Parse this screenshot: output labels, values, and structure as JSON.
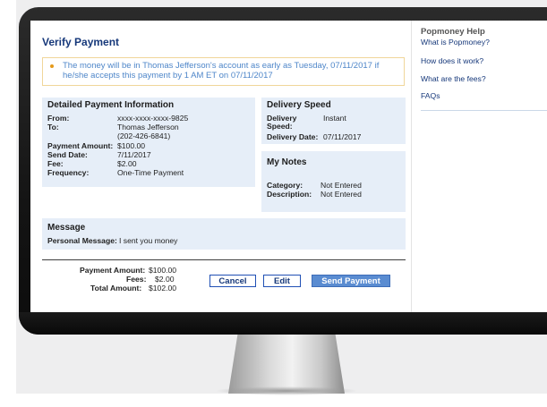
{
  "page": {
    "title": "Verify Payment",
    "notice": "The money will be in Thomas Jefferson's account as early as Tuesday, 07/11/2017 if he/she accepts this payment by 1 AM ET on 07/11/2017"
  },
  "details": {
    "title": "Detailed Payment Information",
    "from_label": "From:",
    "from_value": "xxxx-xxxx-xxxx-9825",
    "to_label": "To:",
    "to_name": "Thomas Jefferson",
    "to_phone": "(202-426-6841)",
    "amount_label": "Payment Amount:",
    "amount_value": "$100.00",
    "send_date_label": "Send Date:",
    "send_date_value": "7/11/2017",
    "fee_label": "Fee:",
    "fee_value": "$2.00",
    "frequency_label": "Frequency:",
    "frequency_value": "One-Time Payment"
  },
  "delivery": {
    "title": "Delivery Speed",
    "speed_label_1": "Delivery",
    "speed_label_2": "Speed:",
    "speed_value": "Instant",
    "date_label": "Delivery Date:",
    "date_value": "07/11/2017"
  },
  "notes": {
    "title": "My Notes",
    "category_label": "Category:",
    "category_value": "Not Entered",
    "description_label": "Description:",
    "description_value": "Not Entered"
  },
  "message": {
    "title": "Message",
    "label": "Personal Message:",
    "value": "I sent you money"
  },
  "totals": {
    "payment_label": "Payment Amount:",
    "payment_value": "$100.00",
    "fees_label": "Fees:",
    "fees_value": "$2.00",
    "total_label": "Total Amount:",
    "total_value": "$102.00"
  },
  "buttons": {
    "cancel": "Cancel",
    "edit": "Edit",
    "send": "Send Payment"
  },
  "sidebar": {
    "title": "Popmoney Help",
    "links": [
      "What is Popmoney?",
      "How does it work?",
      "What are the fees?",
      "FAQs"
    ]
  },
  "colors": {
    "title_blue": "#16387a",
    "panel_bg": "#e6eef8",
    "notice_text": "#4e86c9",
    "notice_border": "#f0d69a",
    "bullet_orange": "#e59a1a",
    "primary_button": "#5a8cd1"
  }
}
